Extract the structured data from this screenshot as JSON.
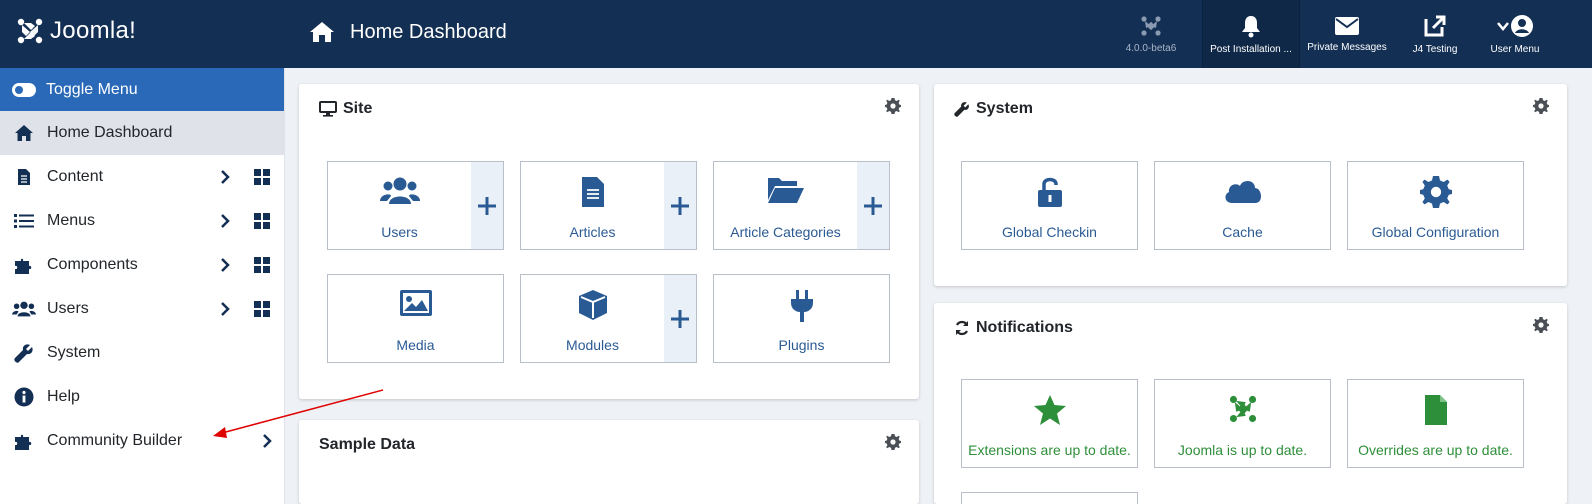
{
  "header": {
    "brand": "Joomla!",
    "page_title": "Home Dashboard",
    "version": "4.0.0-beta6",
    "post_installation": "Post Installation ...",
    "private_messages": "Private Messages",
    "j4_testing": "J4 Testing",
    "user_menu": "User Menu"
  },
  "sidebar": {
    "toggle": "Toggle Menu",
    "items": [
      {
        "label": "Home Dashboard",
        "icon": "home-icon"
      },
      {
        "label": "Content",
        "icon": "file-icon"
      },
      {
        "label": "Menus",
        "icon": "list-icon"
      },
      {
        "label": "Components",
        "icon": "puzzle-icon"
      },
      {
        "label": "Users",
        "icon": "users-icon"
      },
      {
        "label": "System",
        "icon": "wrench-icon"
      },
      {
        "label": "Help",
        "icon": "info-icon"
      },
      {
        "label": "Community Builder",
        "icon": "puzzle-icon"
      }
    ]
  },
  "site": {
    "title": "Site",
    "tiles": [
      "Users",
      "Articles",
      "Article Categories",
      "Media",
      "Modules",
      "Plugins"
    ]
  },
  "system": {
    "title": "System",
    "tiles": [
      "Global Checkin",
      "Cache",
      "Global Configuration"
    ]
  },
  "notifications": {
    "title": "Notifications",
    "tiles": [
      "Extensions are up to date.",
      "Joomla is up to date.",
      "Overrides are up to date."
    ]
  },
  "sample_data": {
    "title": "Sample Data"
  },
  "colors": {
    "header_bg": "#132f53",
    "toggle_bg": "#2a69b8",
    "tile_text": "#2a5a94",
    "success": "#2e8f3a",
    "annotation_arrow": "#e00000"
  }
}
